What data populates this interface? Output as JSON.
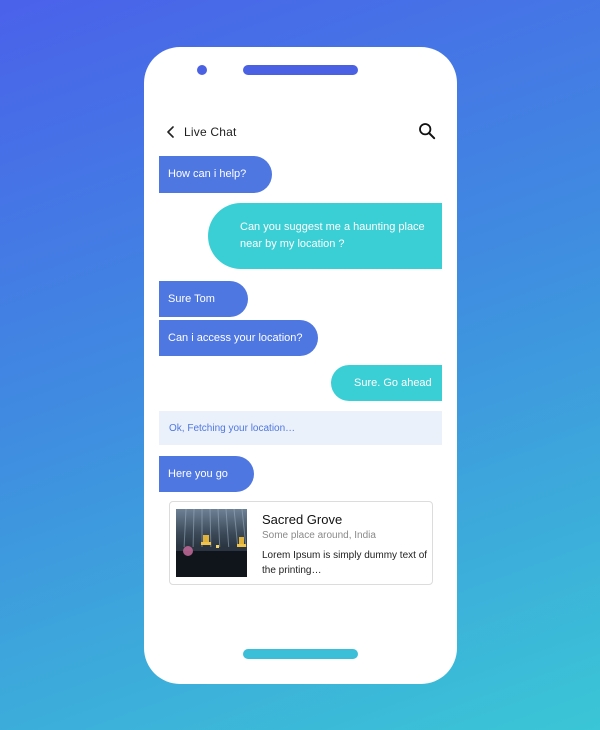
{
  "header": {
    "title": "Live Chat",
    "back_icon": "chevron-left-icon",
    "search_icon": "search-icon"
  },
  "messages": [
    {
      "from": "agent",
      "text": "How can i help?"
    },
    {
      "from": "user",
      "text": "Can you suggest me a haunting place near by my location ?"
    },
    {
      "from": "agent",
      "text": "Sure Tom"
    },
    {
      "from": "agent",
      "text": "Can i access your location?"
    },
    {
      "from": "user",
      "text": "Sure. Go ahead"
    },
    {
      "from": "agent",
      "text": "Here you go"
    }
  ],
  "status": {
    "text": "Ok, Fetching your location…"
  },
  "place_card": {
    "title": "Sacred Grove",
    "subtitle": "Some place around, India",
    "description": "Lorem Ipsum is simply dummy text of the printing…"
  },
  "colors": {
    "agent_bubble": "#4f77e1",
    "user_bubble": "#3acfd5",
    "status_bg": "#eaf1fb",
    "phone_accent": "#4a61e4",
    "home_bar": "#3bbfd8"
  }
}
